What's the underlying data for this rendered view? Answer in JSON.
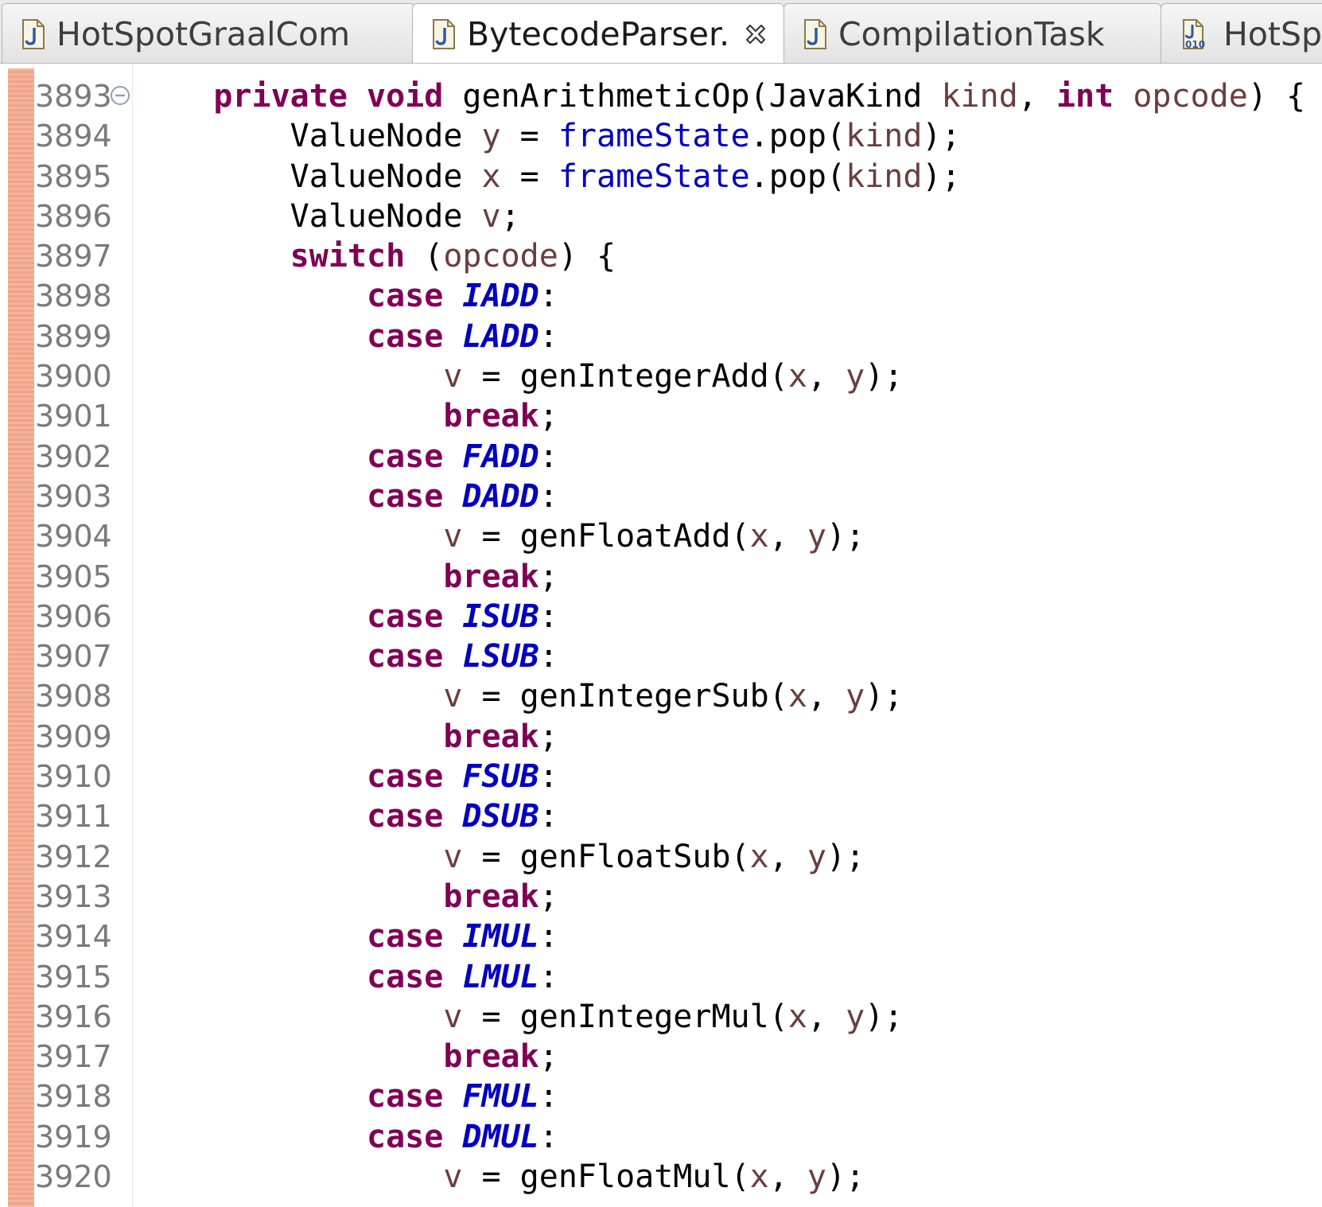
{
  "tabs": [
    {
      "label": "HotSpotGraalCom",
      "icon": "java-file-icon",
      "active": false
    },
    {
      "label": "BytecodeParser.",
      "icon": "java-file-icon",
      "active": true,
      "closable": true
    },
    {
      "label": "CompilationTask",
      "icon": "java-file-icon",
      "active": false
    },
    {
      "label": "HotSp",
      "icon": "class-file-icon",
      "active": false
    }
  ],
  "class_icon_text": "010",
  "colors": {
    "keyword": "#7f0055",
    "field": "#0000c0",
    "constant": "#0000c0",
    "local_variable": "#6a3e3e",
    "line_number": "#7a7a7a",
    "change_strip": "#f4b39a"
  },
  "editor": {
    "lines": [
      {
        "number": "3893",
        "fold": true,
        "tokens": [
          {
            "t": "    ",
            "k": "plain"
          },
          {
            "t": "private",
            "k": "keyword"
          },
          {
            "t": " ",
            "k": "plain"
          },
          {
            "t": "void",
            "k": "keyword"
          },
          {
            "t": " genArithmeticOp(JavaKind ",
            "k": "plain"
          },
          {
            "t": "kind",
            "k": "var"
          },
          {
            "t": ", ",
            "k": "plain"
          },
          {
            "t": "int",
            "k": "keyword"
          },
          {
            "t": " ",
            "k": "plain"
          },
          {
            "t": "opcode",
            "k": "var"
          },
          {
            "t": ") {",
            "k": "plain"
          }
        ]
      },
      {
        "number": "3894",
        "tokens": [
          {
            "t": "        ValueNode ",
            "k": "plain"
          },
          {
            "t": "y",
            "k": "var"
          },
          {
            "t": " = ",
            "k": "plain"
          },
          {
            "t": "frameState",
            "k": "field"
          },
          {
            "t": ".pop(",
            "k": "plain"
          },
          {
            "t": "kind",
            "k": "var"
          },
          {
            "t": ");",
            "k": "plain"
          }
        ]
      },
      {
        "number": "3895",
        "tokens": [
          {
            "t": "        ValueNode ",
            "k": "plain"
          },
          {
            "t": "x",
            "k": "var"
          },
          {
            "t": " = ",
            "k": "plain"
          },
          {
            "t": "frameState",
            "k": "field"
          },
          {
            "t": ".pop(",
            "k": "plain"
          },
          {
            "t": "kind",
            "k": "var"
          },
          {
            "t": ");",
            "k": "plain"
          }
        ]
      },
      {
        "number": "3896",
        "tokens": [
          {
            "t": "        ValueNode ",
            "k": "plain"
          },
          {
            "t": "v",
            "k": "var"
          },
          {
            "t": ";",
            "k": "plain"
          }
        ]
      },
      {
        "number": "3897",
        "tokens": [
          {
            "t": "        ",
            "k": "plain"
          },
          {
            "t": "switch",
            "k": "keyword"
          },
          {
            "t": " (",
            "k": "plain"
          },
          {
            "t": "opcode",
            "k": "var"
          },
          {
            "t": ") {",
            "k": "plain"
          }
        ]
      },
      {
        "number": "3898",
        "tokens": [
          {
            "t": "            ",
            "k": "plain"
          },
          {
            "t": "case",
            "k": "keyword"
          },
          {
            "t": " ",
            "k": "plain"
          },
          {
            "t": "IADD",
            "k": "const"
          },
          {
            "t": ":",
            "k": "plain"
          }
        ]
      },
      {
        "number": "3899",
        "tokens": [
          {
            "t": "            ",
            "k": "plain"
          },
          {
            "t": "case",
            "k": "keyword"
          },
          {
            "t": " ",
            "k": "plain"
          },
          {
            "t": "LADD",
            "k": "const"
          },
          {
            "t": ":",
            "k": "plain"
          }
        ]
      },
      {
        "number": "3900",
        "tokens": [
          {
            "t": "                ",
            "k": "plain"
          },
          {
            "t": "v",
            "k": "var"
          },
          {
            "t": " = genIntegerAdd(",
            "k": "plain"
          },
          {
            "t": "x",
            "k": "var"
          },
          {
            "t": ", ",
            "k": "plain"
          },
          {
            "t": "y",
            "k": "var"
          },
          {
            "t": ");",
            "k": "plain"
          }
        ]
      },
      {
        "number": "3901",
        "tokens": [
          {
            "t": "                ",
            "k": "plain"
          },
          {
            "t": "break",
            "k": "keyword"
          },
          {
            "t": ";",
            "k": "plain"
          }
        ]
      },
      {
        "number": "3902",
        "tokens": [
          {
            "t": "            ",
            "k": "plain"
          },
          {
            "t": "case",
            "k": "keyword"
          },
          {
            "t": " ",
            "k": "plain"
          },
          {
            "t": "FADD",
            "k": "const"
          },
          {
            "t": ":",
            "k": "plain"
          }
        ]
      },
      {
        "number": "3903",
        "tokens": [
          {
            "t": "            ",
            "k": "plain"
          },
          {
            "t": "case",
            "k": "keyword"
          },
          {
            "t": " ",
            "k": "plain"
          },
          {
            "t": "DADD",
            "k": "const"
          },
          {
            "t": ":",
            "k": "plain"
          }
        ]
      },
      {
        "number": "3904",
        "tokens": [
          {
            "t": "                ",
            "k": "plain"
          },
          {
            "t": "v",
            "k": "var"
          },
          {
            "t": " = genFloatAdd(",
            "k": "plain"
          },
          {
            "t": "x",
            "k": "var"
          },
          {
            "t": ", ",
            "k": "plain"
          },
          {
            "t": "y",
            "k": "var"
          },
          {
            "t": ");",
            "k": "plain"
          }
        ]
      },
      {
        "number": "3905",
        "tokens": [
          {
            "t": "                ",
            "k": "plain"
          },
          {
            "t": "break",
            "k": "keyword"
          },
          {
            "t": ";",
            "k": "plain"
          }
        ]
      },
      {
        "number": "3906",
        "tokens": [
          {
            "t": "            ",
            "k": "plain"
          },
          {
            "t": "case",
            "k": "keyword"
          },
          {
            "t": " ",
            "k": "plain"
          },
          {
            "t": "ISUB",
            "k": "const"
          },
          {
            "t": ":",
            "k": "plain"
          }
        ]
      },
      {
        "number": "3907",
        "tokens": [
          {
            "t": "            ",
            "k": "plain"
          },
          {
            "t": "case",
            "k": "keyword"
          },
          {
            "t": " ",
            "k": "plain"
          },
          {
            "t": "LSUB",
            "k": "const"
          },
          {
            "t": ":",
            "k": "plain"
          }
        ]
      },
      {
        "number": "3908",
        "tokens": [
          {
            "t": "                ",
            "k": "plain"
          },
          {
            "t": "v",
            "k": "var"
          },
          {
            "t": " = genIntegerSub(",
            "k": "plain"
          },
          {
            "t": "x",
            "k": "var"
          },
          {
            "t": ", ",
            "k": "plain"
          },
          {
            "t": "y",
            "k": "var"
          },
          {
            "t": ");",
            "k": "plain"
          }
        ]
      },
      {
        "number": "3909",
        "tokens": [
          {
            "t": "                ",
            "k": "plain"
          },
          {
            "t": "break",
            "k": "keyword"
          },
          {
            "t": ";",
            "k": "plain"
          }
        ]
      },
      {
        "number": "3910",
        "tokens": [
          {
            "t": "            ",
            "k": "plain"
          },
          {
            "t": "case",
            "k": "keyword"
          },
          {
            "t": " ",
            "k": "plain"
          },
          {
            "t": "FSUB",
            "k": "const"
          },
          {
            "t": ":",
            "k": "plain"
          }
        ]
      },
      {
        "number": "3911",
        "tokens": [
          {
            "t": "            ",
            "k": "plain"
          },
          {
            "t": "case",
            "k": "keyword"
          },
          {
            "t": " ",
            "k": "plain"
          },
          {
            "t": "DSUB",
            "k": "const"
          },
          {
            "t": ":",
            "k": "plain"
          }
        ]
      },
      {
        "number": "3912",
        "tokens": [
          {
            "t": "                ",
            "k": "plain"
          },
          {
            "t": "v",
            "k": "var"
          },
          {
            "t": " = genFloatSub(",
            "k": "plain"
          },
          {
            "t": "x",
            "k": "var"
          },
          {
            "t": ", ",
            "k": "plain"
          },
          {
            "t": "y",
            "k": "var"
          },
          {
            "t": ");",
            "k": "plain"
          }
        ]
      },
      {
        "number": "3913",
        "tokens": [
          {
            "t": "                ",
            "k": "plain"
          },
          {
            "t": "break",
            "k": "keyword"
          },
          {
            "t": ";",
            "k": "plain"
          }
        ]
      },
      {
        "number": "3914",
        "tokens": [
          {
            "t": "            ",
            "k": "plain"
          },
          {
            "t": "case",
            "k": "keyword"
          },
          {
            "t": " ",
            "k": "plain"
          },
          {
            "t": "IMUL",
            "k": "const"
          },
          {
            "t": ":",
            "k": "plain"
          }
        ]
      },
      {
        "number": "3915",
        "tokens": [
          {
            "t": "            ",
            "k": "plain"
          },
          {
            "t": "case",
            "k": "keyword"
          },
          {
            "t": " ",
            "k": "plain"
          },
          {
            "t": "LMUL",
            "k": "const"
          },
          {
            "t": ":",
            "k": "plain"
          }
        ]
      },
      {
        "number": "3916",
        "tokens": [
          {
            "t": "                ",
            "k": "plain"
          },
          {
            "t": "v",
            "k": "var"
          },
          {
            "t": " = genIntegerMul(",
            "k": "plain"
          },
          {
            "t": "x",
            "k": "var"
          },
          {
            "t": ", ",
            "k": "plain"
          },
          {
            "t": "y",
            "k": "var"
          },
          {
            "t": ");",
            "k": "plain"
          }
        ]
      },
      {
        "number": "3917",
        "tokens": [
          {
            "t": "                ",
            "k": "plain"
          },
          {
            "t": "break",
            "k": "keyword"
          },
          {
            "t": ";",
            "k": "plain"
          }
        ]
      },
      {
        "number": "3918",
        "tokens": [
          {
            "t": "            ",
            "k": "plain"
          },
          {
            "t": "case",
            "k": "keyword"
          },
          {
            "t": " ",
            "k": "plain"
          },
          {
            "t": "FMUL",
            "k": "const"
          },
          {
            "t": ":",
            "k": "plain"
          }
        ]
      },
      {
        "number": "3919",
        "tokens": [
          {
            "t": "            ",
            "k": "plain"
          },
          {
            "t": "case",
            "k": "keyword"
          },
          {
            "t": " ",
            "k": "plain"
          },
          {
            "t": "DMUL",
            "k": "const"
          },
          {
            "t": ":",
            "k": "plain"
          }
        ]
      },
      {
        "number": "3920",
        "tokens": [
          {
            "t": "                ",
            "k": "plain"
          },
          {
            "t": "v",
            "k": "var"
          },
          {
            "t": " = genFloatMul(",
            "k": "plain"
          },
          {
            "t": "x",
            "k": "var"
          },
          {
            "t": ", ",
            "k": "plain"
          },
          {
            "t": "y",
            "k": "var"
          },
          {
            "t": ");",
            "k": "plain"
          }
        ]
      }
    ]
  }
}
